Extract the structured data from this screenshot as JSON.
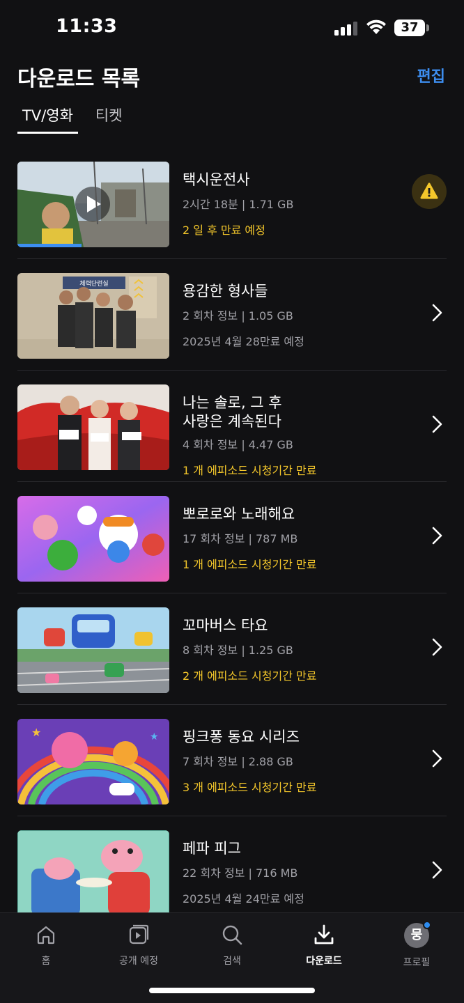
{
  "status_bar": {
    "time": "11:33",
    "battery": "37"
  },
  "header": {
    "title": "다운로드 목록",
    "edit_label": "편집"
  },
  "tabs": [
    {
      "label": "TV/영화",
      "active": true
    },
    {
      "label": "티켓",
      "active": false
    }
  ],
  "items": [
    {
      "title": "택시운전사",
      "meta": "2시간 18분 | 1.71 GB",
      "status": "2 일 후 만료 예정",
      "status_color": "yellow",
      "action": "warning-icon"
    },
    {
      "title": "용감한 형사들",
      "meta": "2 회차 정보 | 1.05 GB",
      "status": "2025년 4월 28만료 예정",
      "status_color": "gray",
      "action": "chevron-right-icon"
    },
    {
      "title": "나는 솔로, 그 후\n사랑은 계속된다",
      "meta": "4 회차 정보 | 4.47 GB",
      "status": "1 개 에피소드 시청기간 만료",
      "status_color": "yellow",
      "action": "chevron-right-icon"
    },
    {
      "title": "뽀로로와 노래해요",
      "meta": "17 회차 정보 | 787 MB",
      "status": "1 개 에피소드 시청기간 만료",
      "status_color": "yellow",
      "action": "chevron-right-icon"
    },
    {
      "title": "꼬마버스 타요",
      "meta": "8 회차 정보 | 1.25 GB",
      "status": "2 개 에피소드 시청기간 만료",
      "status_color": "yellow",
      "action": "chevron-right-icon"
    },
    {
      "title": "핑크퐁 동요 시리즈",
      "meta": "7 회차 정보 | 2.88 GB",
      "status": "3 개 에피소드 시청기간 만료",
      "status_color": "yellow",
      "action": "chevron-right-icon"
    },
    {
      "title": "페파 피그",
      "meta": "22 회차 정보 | 716 MB",
      "status": "2025년 4월 24만료 예정",
      "status_color": "gray",
      "action": "chevron-right-icon"
    }
  ],
  "first_item_progress": 0.42,
  "bottom_nav": [
    {
      "label": "홈",
      "icon": "home-icon",
      "active": false
    },
    {
      "label": "공개 예정",
      "icon": "upcoming-icon",
      "active": false
    },
    {
      "label": "검색",
      "icon": "search-icon",
      "active": false
    },
    {
      "label": "다운로드",
      "icon": "download-icon",
      "active": true
    },
    {
      "label": "프로필",
      "icon": "profile-avatar",
      "active": false,
      "avatar_text": "뭉"
    }
  ],
  "colors": {
    "accent": "#3d8ef0",
    "warning": "#f4c72b",
    "background": "#111113"
  }
}
